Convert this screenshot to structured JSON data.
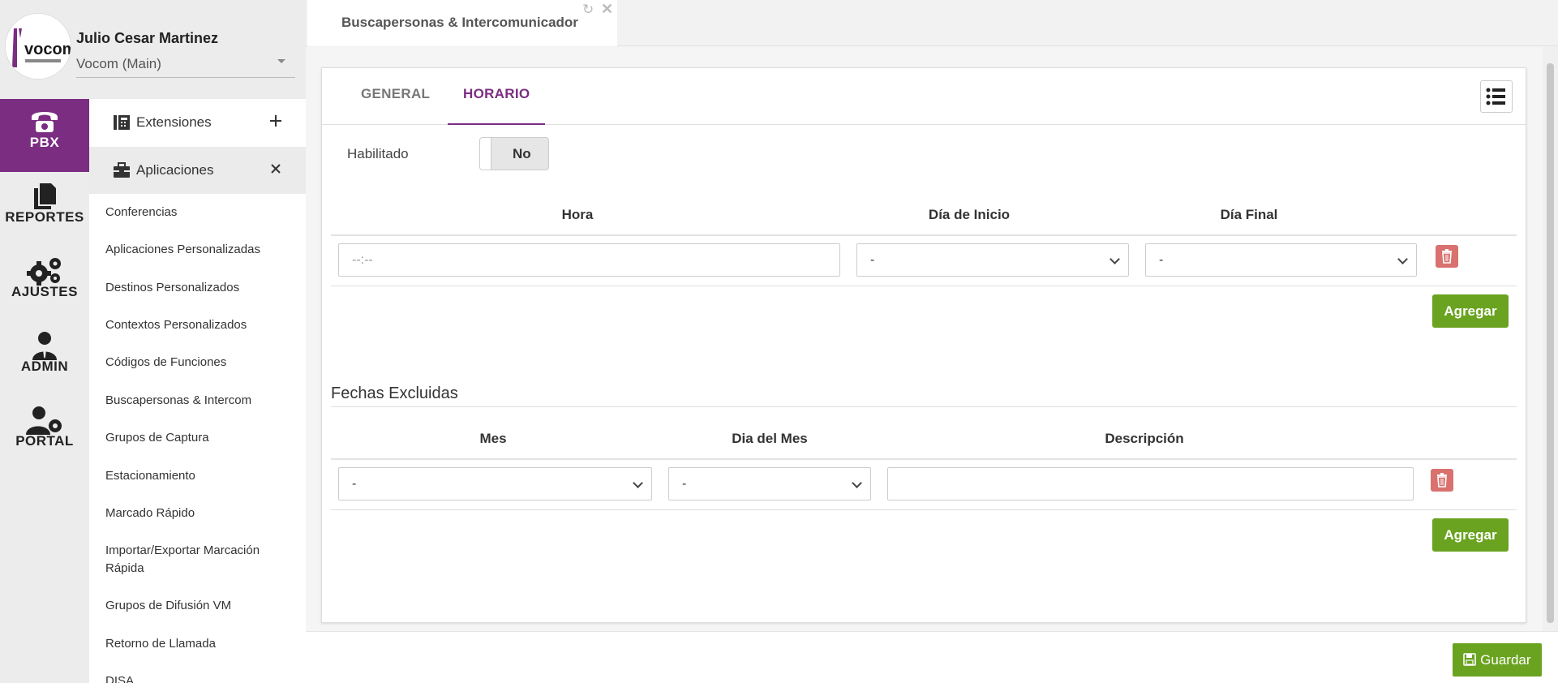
{
  "profile": {
    "user_name": "Julio Cesar Martinez",
    "tenant": "Vocom (Main)",
    "logo_text": "vocom"
  },
  "rail": [
    {
      "label": "PBX",
      "icon": "phone-icon",
      "active": true
    },
    {
      "label": "REPORTES",
      "icon": "documents-icon",
      "active": false
    },
    {
      "label": "AJUSTES",
      "icon": "gears-icon",
      "active": false
    },
    {
      "label": "ADMIN",
      "icon": "user-tie-icon",
      "active": false
    },
    {
      "label": "PORTAL",
      "icon": "user-gear-icon",
      "active": false
    }
  ],
  "submenu": {
    "sections": [
      {
        "label": "Extensiones",
        "icon": "phone-book-icon",
        "action": "+"
      },
      {
        "label": "Aplicaciones",
        "icon": "toolbox-icon",
        "action": "×"
      }
    ],
    "items": [
      "Conferencias",
      "Aplicaciones Personalizadas",
      "Destinos Personalizados",
      "Contextos Personalizados",
      "Códigos de Funciones",
      "Buscapersonas & Intercom",
      "Grupos de Captura",
      "Estacionamiento",
      "Marcado Rápido",
      "Importar/Exportar Marcación Rápida",
      "Grupos de Difusión VM",
      "Retorno de Llamada",
      "DISA"
    ]
  },
  "doc_tab": {
    "title": "Buscapersonas & Intercomunicador"
  },
  "inner_tabs": [
    {
      "label": "GENERAL",
      "active": false
    },
    {
      "label": "HORARIO",
      "active": true
    }
  ],
  "schedule": {
    "enabled_label": "Habilitado",
    "enabled_value": "No",
    "headers": {
      "hour": "Hora",
      "start_day": "Día de Inicio",
      "end_day": "Día Final"
    },
    "row": {
      "hour_placeholder": "--:--",
      "start_day": "-",
      "end_day": "-"
    },
    "add_label": "Agregar"
  },
  "excluded": {
    "title": "Fechas Excluidas",
    "headers": {
      "month": "Mes",
      "day": "Dia del Mes",
      "description": "Descripción"
    },
    "row": {
      "month": "-",
      "day": "-",
      "description": ""
    },
    "add_label": "Agregar"
  },
  "footer": {
    "save_label": "Guardar"
  },
  "colors": {
    "accent_purple": "#7b2d82",
    "button_green": "#6aa320",
    "delete_red": "#d9716f"
  }
}
